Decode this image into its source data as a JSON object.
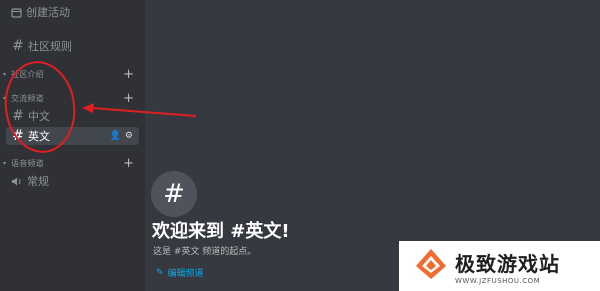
{
  "sidebar": {
    "items": [
      {
        "icon": "calendar-icon",
        "label": "创建活动"
      },
      {
        "icon": "hash-icon",
        "label": "社区规则"
      },
      {
        "category": "社区介绍"
      },
      {
        "category": "交流频道"
      },
      {
        "icon": "hash-icon",
        "label": "中文"
      },
      {
        "icon": "hash-icon",
        "label": "英文",
        "active": true
      },
      {
        "category": "语音频道"
      },
      {
        "icon": "speaker-icon",
        "label": "常规"
      }
    ]
  },
  "main": {
    "welcome_icon": "#",
    "title": "欢迎来到 #英文!",
    "subtitle": "这是 #英文 频道的起点。",
    "edit_link": "编辑频道"
  },
  "watermark": {
    "title": "极致游戏站",
    "url": "WWW.JZFUSHOU.COM"
  },
  "colors": {
    "annotation": "#e02020",
    "accent": "#00aff4"
  }
}
